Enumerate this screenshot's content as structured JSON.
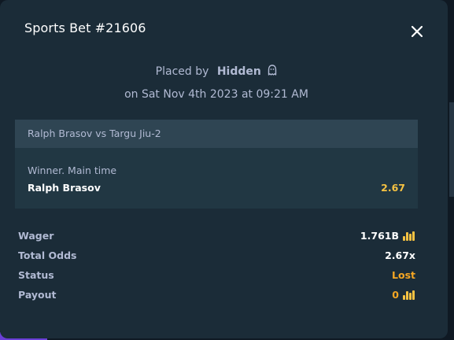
{
  "modal": {
    "title": "Sports Bet #21606",
    "placed_by_label": "Placed by",
    "placed_by_user": "Hidden",
    "placed_on": "on Sat Nov 4th 2023 at 09:21 AM"
  },
  "bet": {
    "event": "Ralph Brasov vs Targu Jiu-2",
    "market": "Winner. Main time",
    "outcome": "Ralph Brasov",
    "odds": "2.67"
  },
  "summary": {
    "wager_label": "Wager",
    "wager_value": "1.761B",
    "total_odds_label": "Total Odds",
    "total_odds_value": "2.67x",
    "status_label": "Status",
    "status_value": "Lost",
    "payout_label": "Payout",
    "payout_value": "0"
  },
  "icons": {
    "close": "close-icon",
    "ghost": "ghost-icon",
    "currency": "gold-bars-icon"
  },
  "colors": {
    "modal_bg": "#1b2c38",
    "card_bg": "#213743",
    "card_header_bg": "#2f4553",
    "accent_gold": "#f5c242",
    "status_lost": "#f5a623",
    "text_muted": "#b1bad3"
  }
}
